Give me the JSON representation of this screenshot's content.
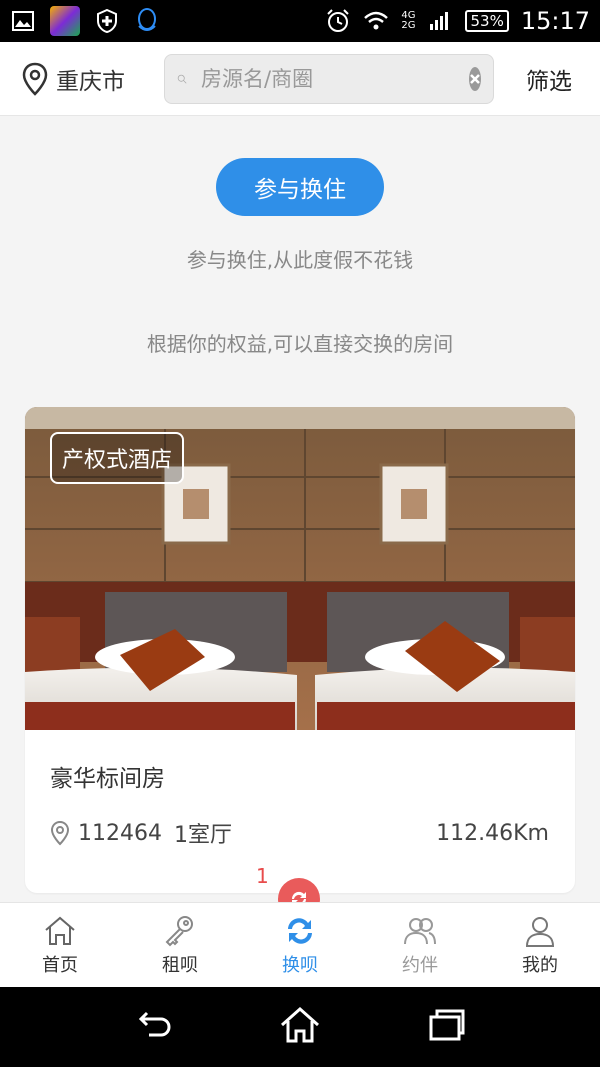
{
  "status_bar": {
    "time": "15:17",
    "battery": "53%",
    "network_top": "4G",
    "network_bottom": "2G",
    "icons": [
      "gallery-icon",
      "game-app-icon",
      "shield-icon",
      "qq-icon",
      "alarm-icon",
      "wifi-icon",
      "signal-icon",
      "battery-icon"
    ]
  },
  "header": {
    "city": "重庆市",
    "search_placeholder": "房源名/商圈",
    "filter_label": "筛选"
  },
  "main": {
    "join_button": "参与换住",
    "subtitle_1": "参与换住,从此度假不花钱",
    "subtitle_2": "根据你的权益,可以直接交换的房间"
  },
  "listing": {
    "tag": "产权式酒店",
    "title": "豪华标间房",
    "code": "112464",
    "layout": "1室厅",
    "distance": "112.46Km"
  },
  "badge_count": "1",
  "tabs": [
    {
      "label": "首页",
      "icon": "home-icon"
    },
    {
      "label": "租呗",
      "icon": "key-icon"
    },
    {
      "label": "换呗",
      "icon": "exchange-icon"
    },
    {
      "label": "约伴",
      "icon": "companions-icon"
    },
    {
      "label": "我的",
      "icon": "profile-icon"
    }
  ],
  "colors": {
    "accent": "#2f8fe8",
    "badge": "#e95b5b"
  }
}
